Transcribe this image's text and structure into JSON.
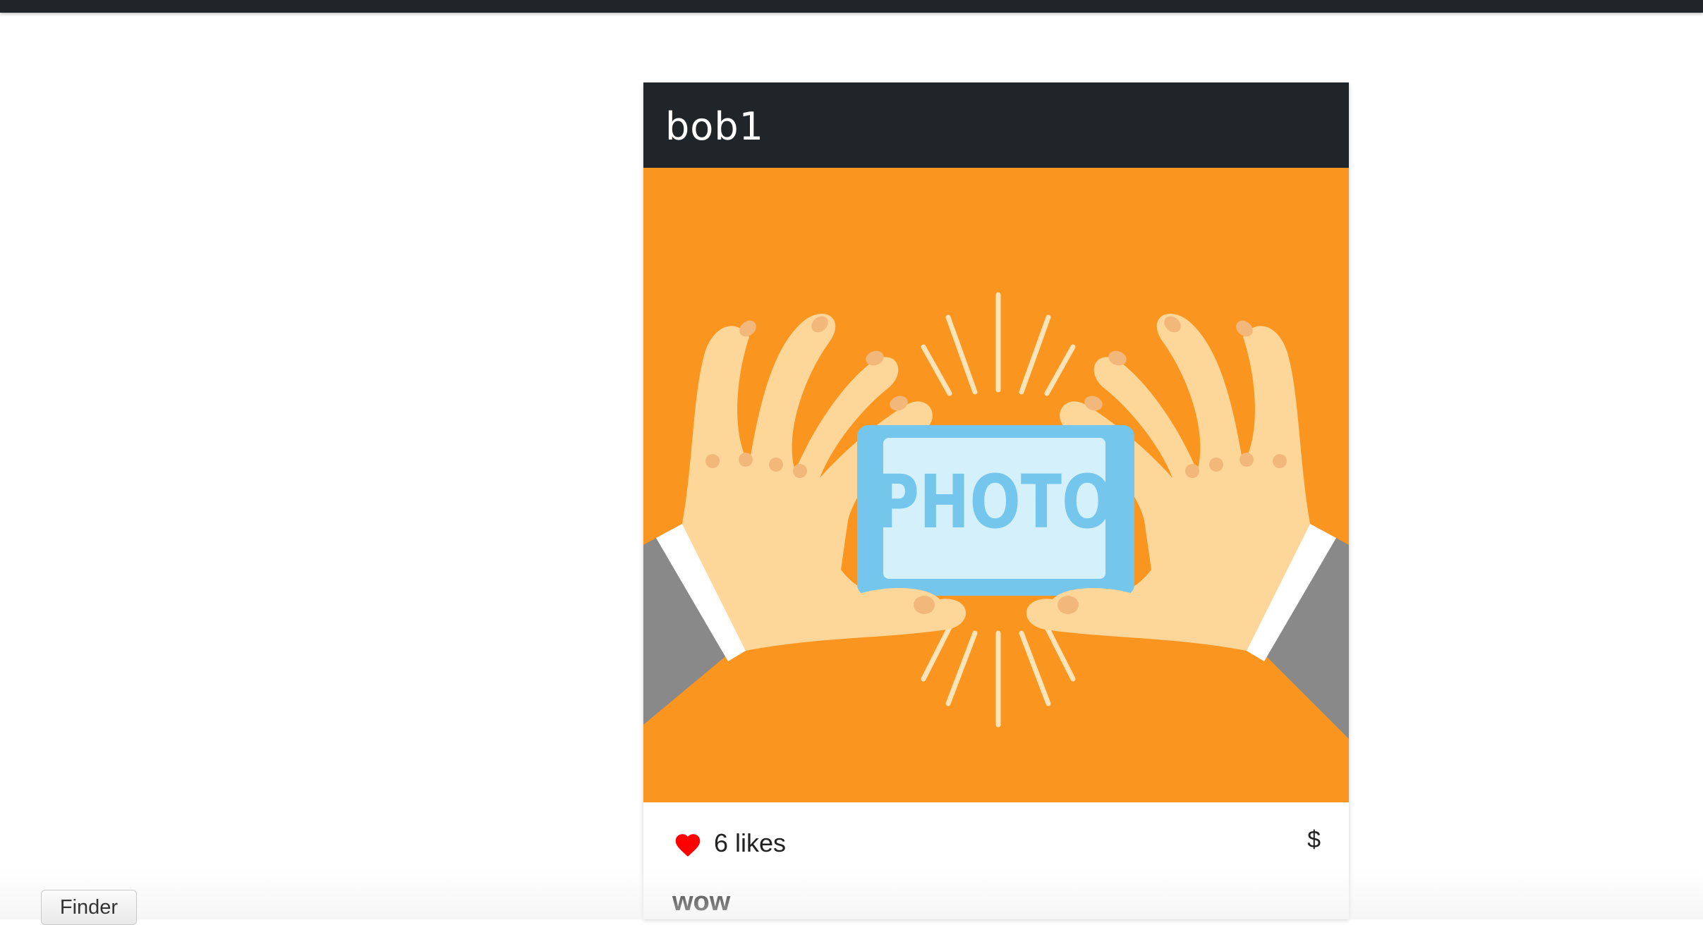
{
  "post": {
    "username": "bob1",
    "image": {
      "text": "PHOTO",
      "background": "#fa9520",
      "screen_color": "#75c6ec",
      "screen_inner": "#d4f1fb",
      "skin_color": "#fdd79a",
      "sleeve_color": "#898989"
    },
    "likes_label": "6 likes",
    "like_icon": "heart-icon",
    "like_color": "#ff0000",
    "price_label": "$",
    "caption": "wow"
  },
  "dock": {
    "finder_label": "Finder"
  },
  "colors": {
    "header_background": "#1f2529",
    "page_background": "#ffffff"
  }
}
